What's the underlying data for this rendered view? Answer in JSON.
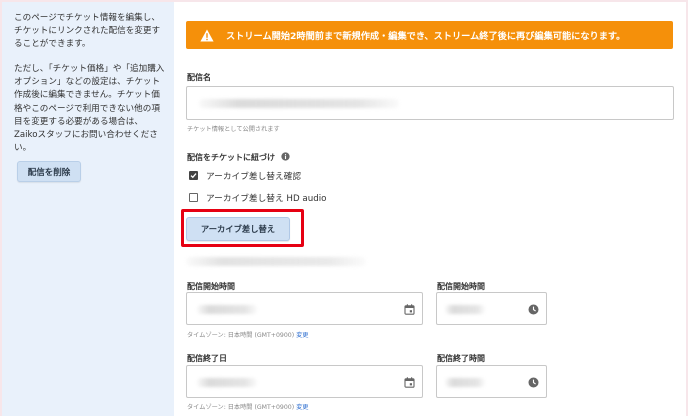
{
  "sidebar": {
    "info_text": "このページでチケット情報を編集し、チケットにリンクされた配信を変更することができます。",
    "note_text": "ただし、「チケット価格」や「追加購入オプション」などの設定は、チケット作成後に編集できません。チケット価格やこのページで利用できない他の項目を変更する必要がある場合は、Zaikoスタッフにお問い合わせください。",
    "delete_button": "配信を削除"
  },
  "alert": {
    "text": "ストリーム開始2時間前まで新規作成・編集でき、ストリーム終了後に再び編集可能になります。",
    "icon": "warning-icon"
  },
  "stream_name": {
    "label": "配信名",
    "hint": "チケット情報として公開されます"
  },
  "link_section": {
    "label": "配信をチケットに紐づけ",
    "options": [
      {
        "label": "アーカイブ差し替え確認",
        "checked": true
      },
      {
        "label": "アーカイブ差し替え HD audio",
        "checked": false
      }
    ]
  },
  "archive_button": "アーカイブ差し替え",
  "schedule": {
    "start_date_label": "配信開始時間",
    "start_time_label": "配信開始時間",
    "end_date_label": "配信終了日",
    "end_time_label": "配信終了時間",
    "timezone_prefix": "タイムゾーン: 日本時間 (GMT+0900)",
    "timezone_link": "変更"
  },
  "colors": {
    "alert_bg": "#f5900a",
    "highlight": "#e60012",
    "sidebar_bg": "#e9f1fb",
    "button_bg": "#cfe0f3"
  }
}
